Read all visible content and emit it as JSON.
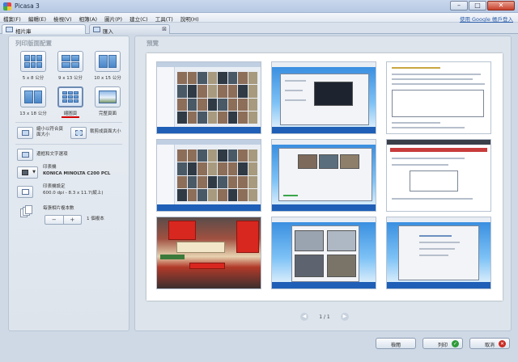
{
  "window": {
    "title": "Picasa 3"
  },
  "menu": {
    "items": [
      "檔案(F)",
      "編輯(E)",
      "檢視(V)",
      "相簿(A)",
      "圖片(P)",
      "建立(C)",
      "工具(T)",
      "說明(H)"
    ],
    "google_link": "使用 Google 帳戶登入"
  },
  "tabs": [
    {
      "label": "相片庫"
    },
    {
      "label": "匯入"
    }
  ],
  "left": {
    "section_title": "列印版面配置",
    "layouts": [
      {
        "label": "5 x 8 公分"
      },
      {
        "label": "9 x 13 公分"
      },
      {
        "label": "10 x 15 公分"
      },
      {
        "label": "13 x 18 公分"
      },
      {
        "label": "縮圖頁"
      },
      {
        "label": "完整頁面"
      }
    ],
    "fit_label": "縮小以符合頁面大小",
    "crop_label": "裁剪成頁面大小",
    "border_text_label": "邊框和文字選項",
    "printer_label": "印表機",
    "printer_name": "KONICA MINOLTA C200 PCL",
    "printer_settings_label": "印表機設定",
    "printer_settings_value": "600.0 dpi - 8.3 x 11.7(縱上)",
    "copies_label": "每張相片複本數",
    "stepper_minus": "−",
    "stepper_plus": "+",
    "copies_value": "1 個複本"
  },
  "preview": {
    "title": "預覽",
    "page_indicator": "1 / 1",
    "prev_arrow": "◀",
    "next_arrow": "▶"
  },
  "footer": {
    "back_label": "檢閱",
    "print_label": "列印",
    "cancel_label": "取消",
    "ok_glyph": "✓",
    "x_glyph": "✕"
  },
  "colors": {
    "selection_underline": "#d40000",
    "taskbar_blue": "#1f5fb7"
  }
}
